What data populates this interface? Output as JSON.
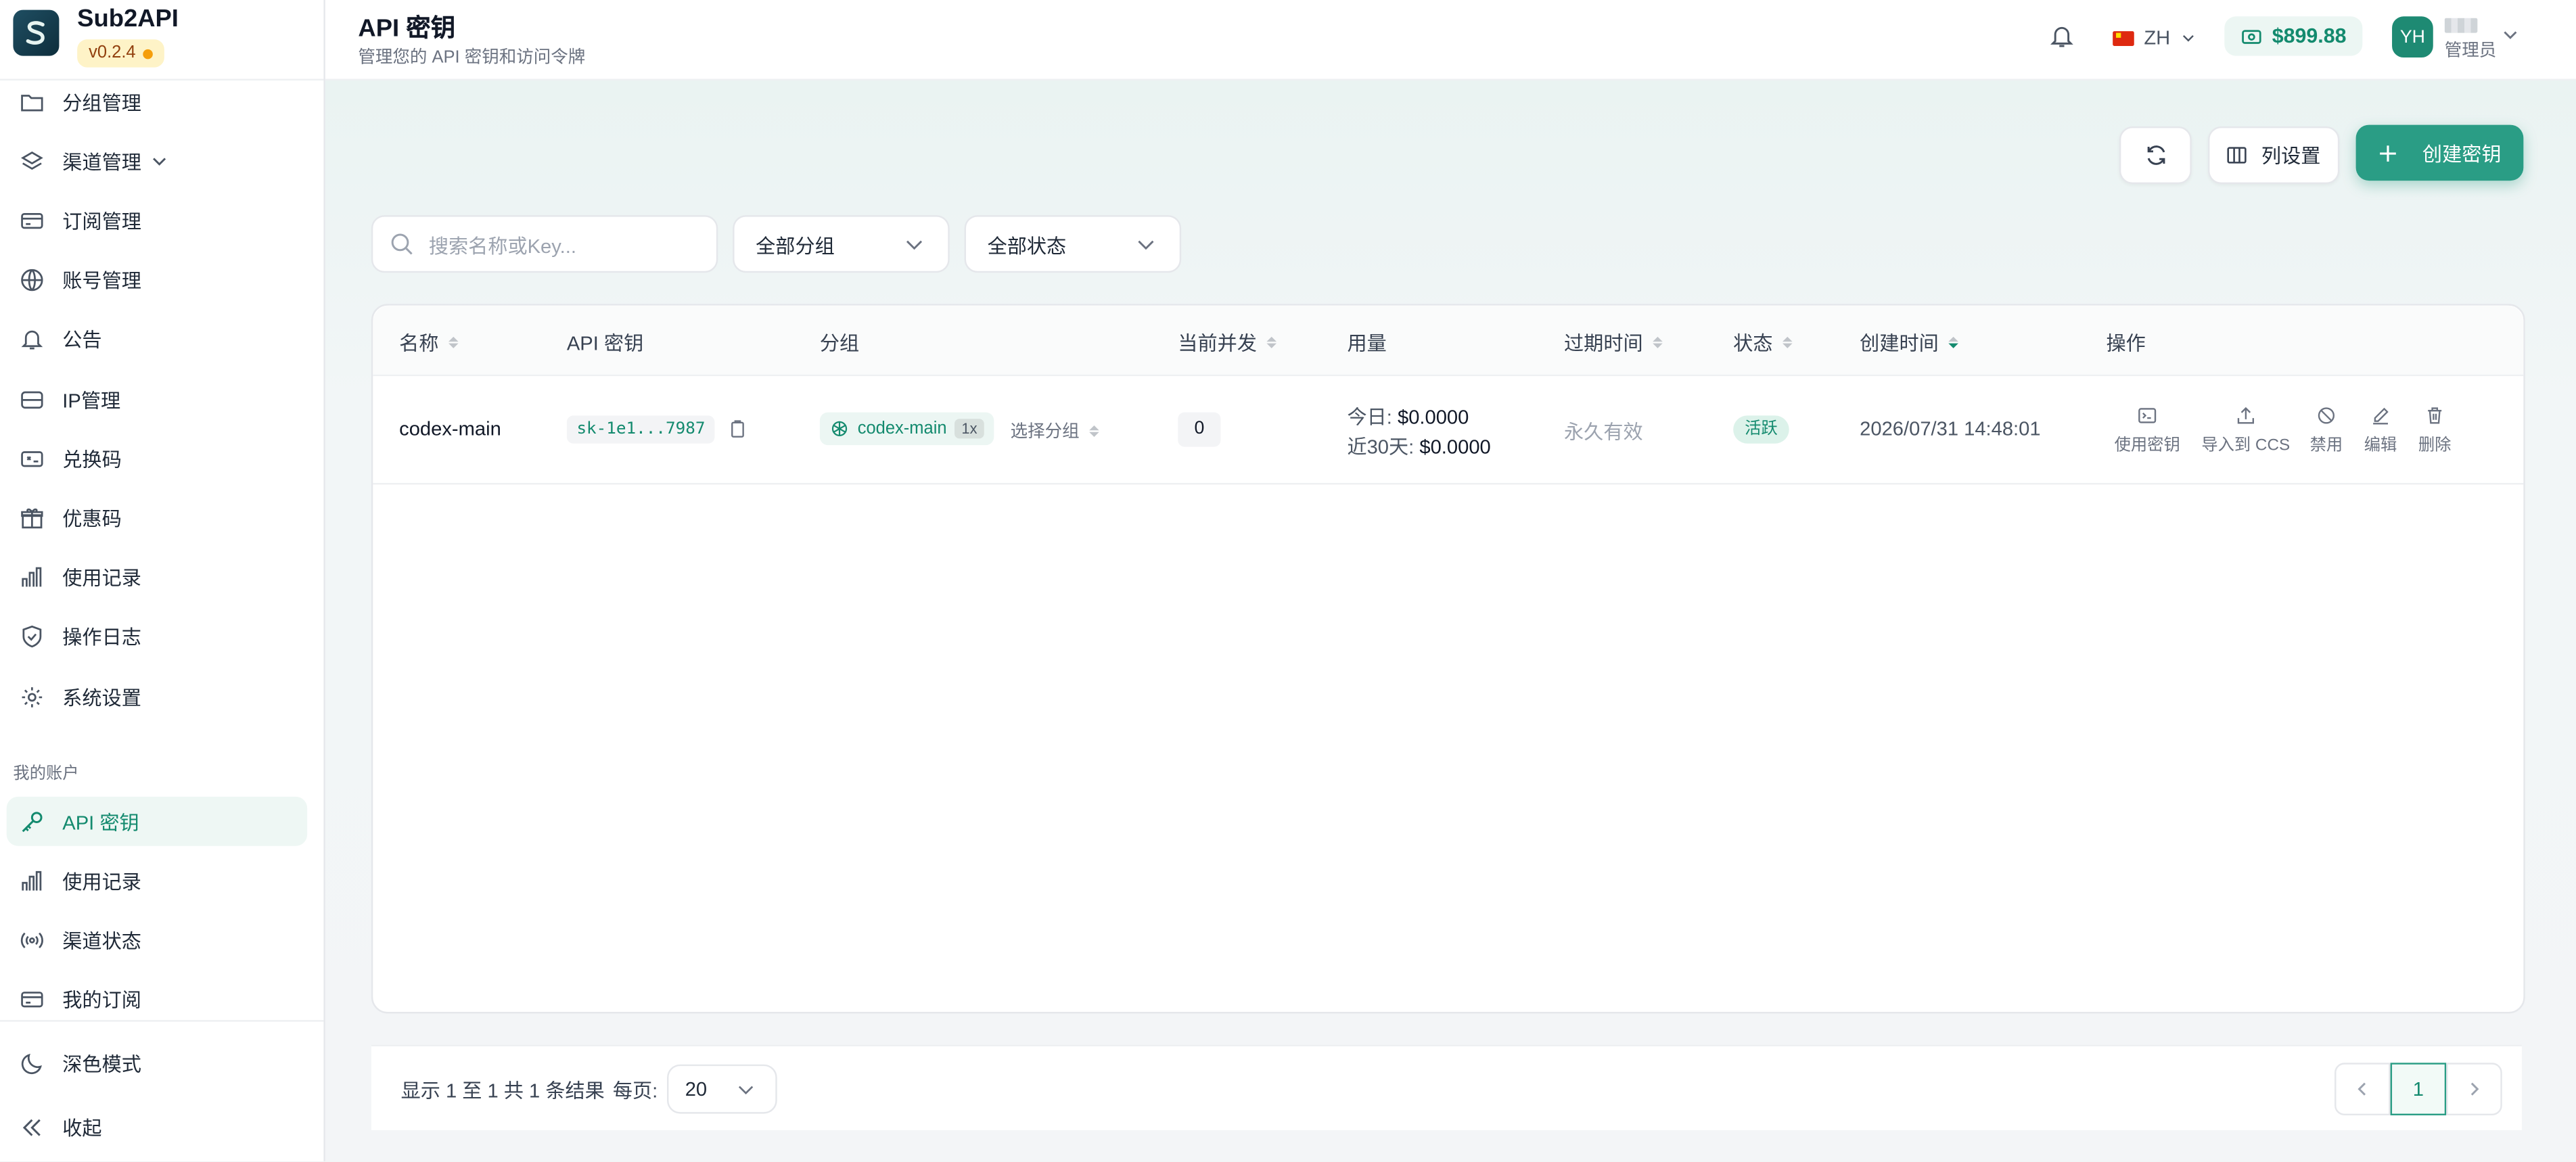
{
  "app": {
    "name": "Sub2API",
    "version": "v0.2.4"
  },
  "sidebar": {
    "admin_items": [
      {
        "label": "分组管理",
        "icon": "folder-icon"
      },
      {
        "label": "渠道管理",
        "icon": "layers-icon"
      },
      {
        "label": "订阅管理",
        "icon": "card-icon"
      },
      {
        "label": "账号管理",
        "icon": "globe-icon"
      },
      {
        "label": "公告",
        "icon": "bell-icon"
      },
      {
        "label": "IP管理",
        "icon": "server-icon"
      },
      {
        "label": "兑换码",
        "icon": "ticket-icon"
      },
      {
        "label": "优惠码",
        "icon": "gift-icon"
      },
      {
        "label": "使用记录",
        "icon": "bar-chart-icon"
      },
      {
        "label": "操作日志",
        "icon": "shield-icon"
      },
      {
        "label": "系统设置",
        "icon": "gear-icon"
      }
    ],
    "section_label": "我的账户",
    "account_items": [
      {
        "label": "API 密钥",
        "icon": "key-icon",
        "active": true
      },
      {
        "label": "使用记录",
        "icon": "bar-chart-icon"
      },
      {
        "label": "渠道状态",
        "icon": "broadcast-icon"
      },
      {
        "label": "我的订阅",
        "icon": "card-icon"
      }
    ],
    "dark_mode": "深色模式",
    "collapse": "收起"
  },
  "header": {
    "title": "API 密钥",
    "subtitle": "管理您的 API 密钥和访问令牌",
    "lang": "ZH",
    "balance": "$899.88",
    "avatar": "YH",
    "role": "管理员"
  },
  "toolbar": {
    "columns": "列设置",
    "create": "创建密钥",
    "search_placeholder": "搜索名称或Key...",
    "group_filter": "全部分组",
    "status_filter": "全部状态"
  },
  "table": {
    "columns": [
      "名称",
      "API 密钥",
      "分组",
      "当前并发",
      "用量",
      "过期时间",
      "状态",
      "创建时间",
      "操作"
    ],
    "rows": [
      {
        "name": "codex-main",
        "key": "sk-1e1...7987",
        "group": "codex-main",
        "rate": "1x",
        "pick_group": "选择分组",
        "concurrency": "0",
        "usage_today_label": "今日:",
        "usage_today": "$0.0000",
        "usage_30_label": "近30天:",
        "usage_30": "$0.0000",
        "expires": "永久有效",
        "status": "活跃",
        "created": "2026/07/31 14:48:01",
        "actions": [
          "使用密钥",
          "导入到 CCS",
          "禁用",
          "编辑",
          "删除"
        ]
      }
    ]
  },
  "pagination": {
    "summary": "显示 1 至 1 共 1 条结果",
    "per_page_label": "每页:",
    "per_page": "20",
    "current": "1"
  },
  "colors": {
    "accent": "#2a9d85",
    "accent_text": "#138a6e"
  }
}
